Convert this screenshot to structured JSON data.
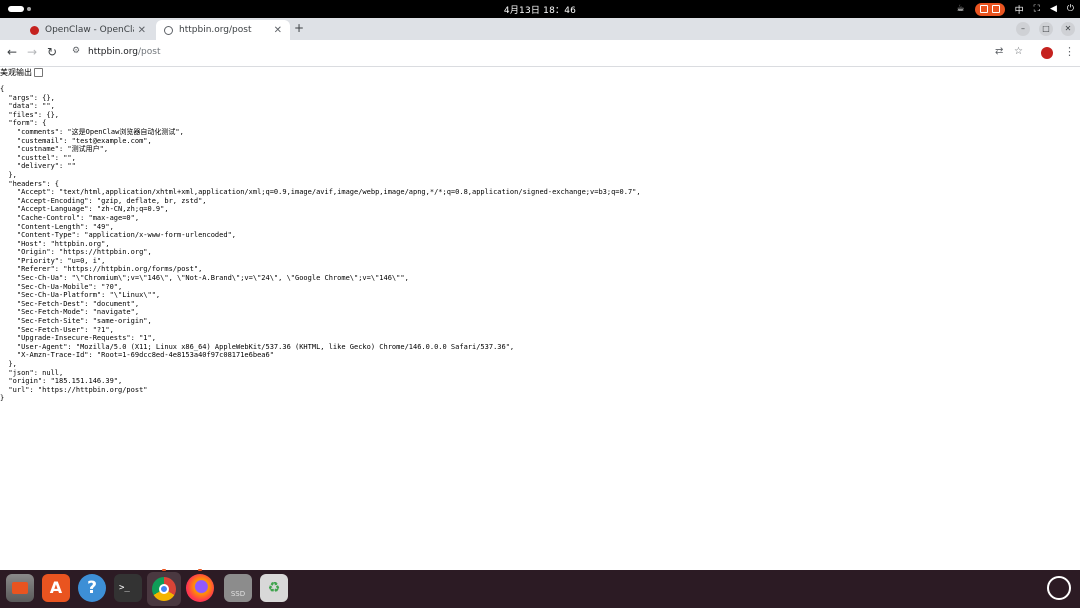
{
  "topbar": {
    "clock": "4月13日  18：46",
    "input_method": "中"
  },
  "tabs": [
    {
      "title": "OpenClaw - OpenClaw",
      "favicon": "claw-icon",
      "active": false
    },
    {
      "title": "httpbin.org/post",
      "favicon": "globe-icon",
      "active": true
    }
  ],
  "address_bar": {
    "host": "httpbin.org",
    "path": "/post"
  },
  "page": {
    "pretty_print_label": "美观输出",
    "json_text": "{\n  \"args\": {},\n  \"data\": \"\",\n  \"files\": {},\n  \"form\": {\n    \"comments\": \"这是OpenClaw浏览器自动化测试\",\n    \"custemail\": \"test@example.com\",\n    \"custname\": \"测试用户\",\n    \"custtel\": \"\",\n    \"delivery\": \"\"\n  },\n  \"headers\": {\n    \"Accept\": \"text/html,application/xhtml+xml,application/xml;q=0.9,image/avif,image/webp,image/apng,*/*;q=0.8,application/signed-exchange;v=b3;q=0.7\",\n    \"Accept-Encoding\": \"gzip, deflate, br, zstd\",\n    \"Accept-Language\": \"zh-CN,zh;q=0.9\",\n    \"Cache-Control\": \"max-age=0\",\n    \"Content-Length\": \"49\",\n    \"Content-Type\": \"application/x-www-form-urlencoded\",\n    \"Host\": \"httpbin.org\",\n    \"Origin\": \"https://httpbin.org\",\n    \"Priority\": \"u=0, i\",\n    \"Referer\": \"https://httpbin.org/forms/post\",\n    \"Sec-Ch-Ua\": \"\\\"Chromium\\\";v=\\\"146\\\", \\\"Not-A.Brand\\\";v=\\\"24\\\", \\\"Google Chrome\\\";v=\\\"146\\\"\",\n    \"Sec-Ch-Ua-Mobile\": \"?0\",\n    \"Sec-Ch-Ua-Platform\": \"\\\"Linux\\\"\",\n    \"Sec-Fetch-Dest\": \"document\",\n    \"Sec-Fetch-Mode\": \"navigate\",\n    \"Sec-Fetch-Site\": \"same-origin\",\n    \"Sec-Fetch-User\": \"?1\",\n    \"Upgrade-Insecure-Requests\": \"1\",\n    \"User-Agent\": \"Mozilla/5.0 (X11; Linux x86_64) AppleWebKit/537.36 (KHTML, like Gecko) Chrome/146.0.0.0 Safari/537.36\",\n    \"X-Amzn-Trace-Id\": \"Root=1-69dcc8ed-4e8153a40f97c08171e6bea6\"\n  },\n  \"json\": null,\n  \"origin\": \"185.151.146.39\",\n  \"url\": \"https://httpbin.org/post\"\n}"
  },
  "dock": {
    "apps": [
      "files-icon",
      "app-center-icon",
      "help-icon",
      "terminal-icon",
      "chrome-icon",
      "firefox-icon",
      "ssd-drive-icon",
      "trash-icon"
    ],
    "terminal_glyph": ">_",
    "store_glyph": "A",
    "help_glyph": "?",
    "ssd_label": "SSD",
    "trash_glyph": "♻"
  },
  "colors": {
    "accent": "#e95420",
    "dock_background": "#2c1b24",
    "tabstrip_background": "#dee1e6"
  }
}
